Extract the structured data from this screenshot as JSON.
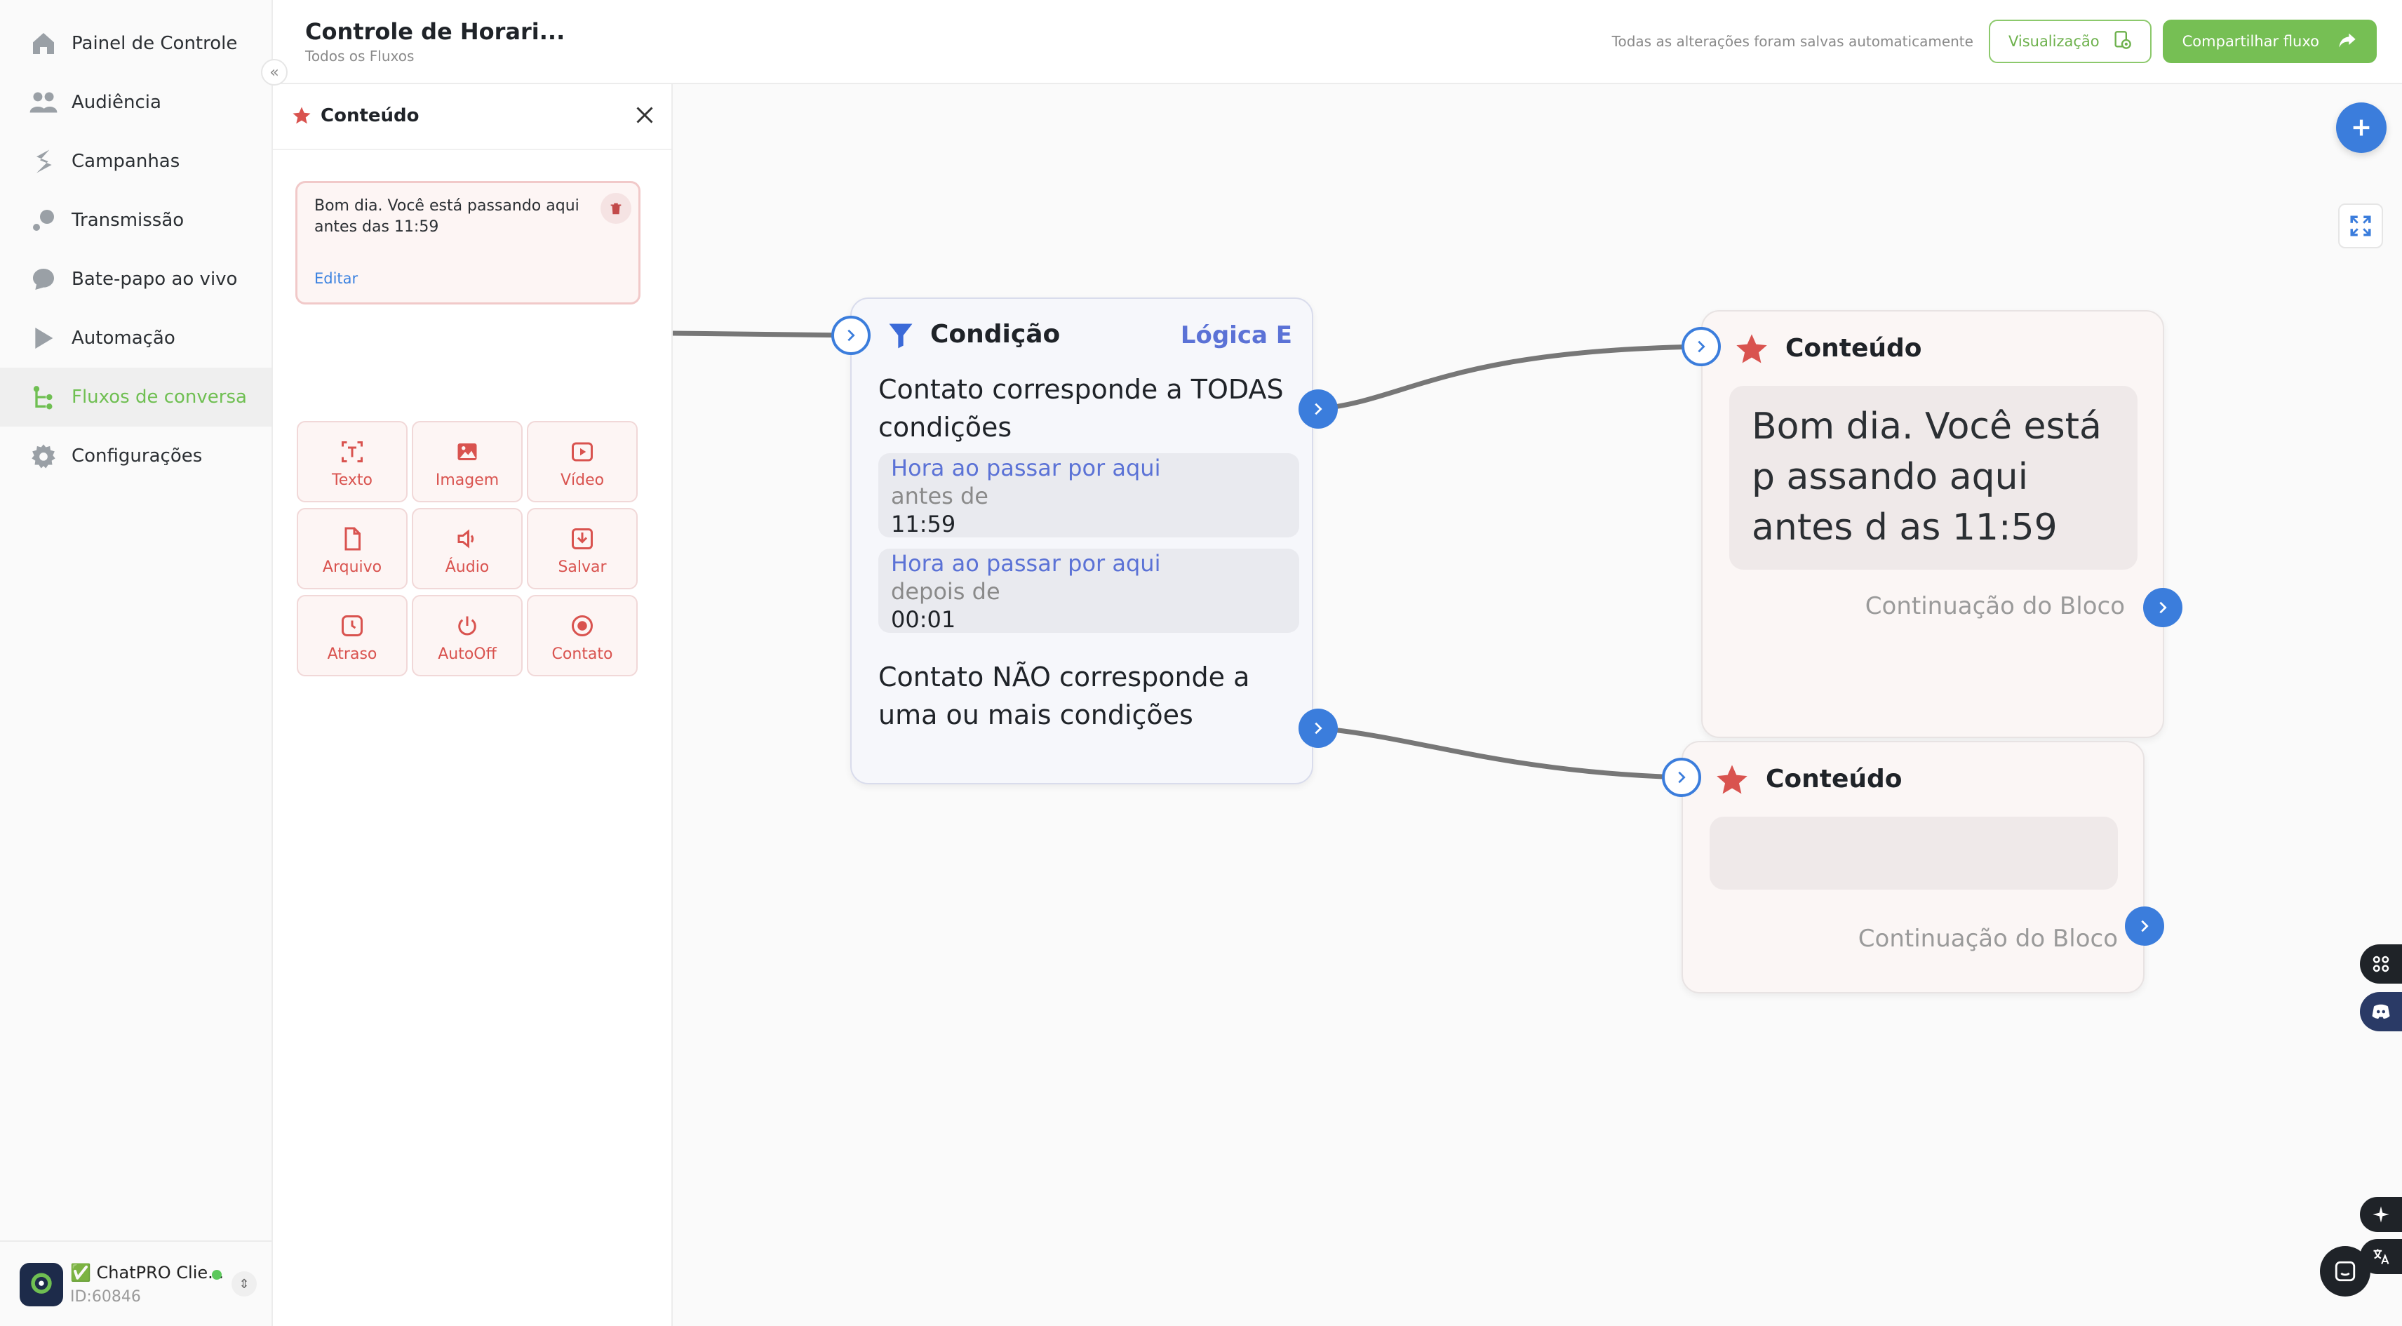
{
  "sidebar": {
    "items": [
      {
        "label": "Painel de Controle",
        "icon": "home-icon"
      },
      {
        "label": "Audiência",
        "icon": "users-icon"
      },
      {
        "label": "Campanhas",
        "icon": "campaign-icon"
      },
      {
        "label": "Transmissão",
        "icon": "broadcast-icon"
      },
      {
        "label": "Bate-papo ao vivo",
        "icon": "chat-bubble-icon"
      },
      {
        "label": "Automação",
        "icon": "automation-icon"
      },
      {
        "label": "Fluxos de conversa",
        "icon": "flow-icon",
        "active": true
      },
      {
        "label": "Configurações",
        "icon": "gear-icon"
      }
    ],
    "account": {
      "name": "✅ ChatPRO Clie...",
      "id": "ID:60846"
    }
  },
  "header": {
    "title": "Controle de Horari...",
    "breadcrumb": "Todos os Fluxos",
    "autosave": "Todas as alterações foram salvas automaticamente",
    "preview_label": "Visualização",
    "share_label": "Compartilhar fluxo"
  },
  "panel": {
    "title": "Conteúdo",
    "message": "Bom dia. Você está passando aqui antes das 11:59",
    "edit_label": "Editar",
    "tiles": [
      {
        "label": "Texto",
        "icon": "text-icon"
      },
      {
        "label": "Imagem",
        "icon": "image-icon"
      },
      {
        "label": "Vídeo",
        "icon": "video-icon"
      },
      {
        "label": "Arquivo",
        "icon": "file-icon"
      },
      {
        "label": "Áudio",
        "icon": "audio-icon"
      },
      {
        "label": "Salvar",
        "icon": "save-icon"
      },
      {
        "label": "Atraso",
        "icon": "clock-icon"
      },
      {
        "label": "AutoOff",
        "icon": "power-icon"
      },
      {
        "label": "Contato",
        "icon": "contact-icon"
      }
    ]
  },
  "canvas": {
    "condition": {
      "title": "Condição",
      "logic": "Lógica E",
      "match_all": "Contato corresponde a TODAS condições",
      "rules": [
        {
          "field": "Hora ao passar por aqui",
          "operator": "antes de",
          "value": "11:59"
        },
        {
          "field": "Hora ao passar por aqui",
          "operator": "depois de",
          "value": "00:01"
        }
      ],
      "no_match": "Contato NÃO corresponde a uma ou mais condições"
    },
    "content_top": {
      "title": "Conteúdo",
      "message": "Bom dia. Você está p assando aqui antes d as 11:59",
      "continuation": "Continuação do Bloco"
    },
    "content_bottom": {
      "title": "Conteúdo",
      "message": "",
      "continuation": "Continuação do Bloco"
    }
  },
  "colors": {
    "accent_green": "#76bf54",
    "accent_blue": "#3b7ddc",
    "content_red": "#d9534f",
    "logic_blue": "#5b72d6"
  }
}
